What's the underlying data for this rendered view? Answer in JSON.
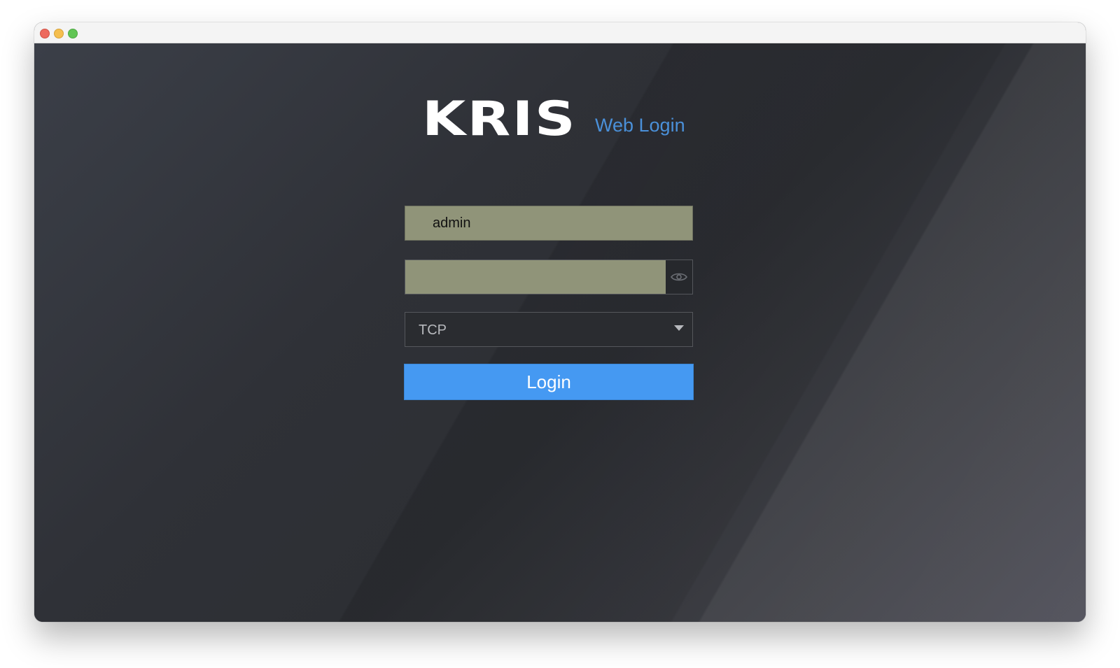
{
  "colors": {
    "accent": "#4599f2",
    "subtitle": "#4a90d9",
    "input_fill": "#909479",
    "background": "#2e3036"
  },
  "header": {
    "logo_text": "KRIS",
    "subtitle": "Web Login"
  },
  "form": {
    "username_value": "admin",
    "password_value": "",
    "password_toggle_icon": "eye-icon",
    "protocol_selected": "TCP",
    "protocol_dropdown_icon": "chevron-down-icon",
    "login_label": "Login"
  }
}
